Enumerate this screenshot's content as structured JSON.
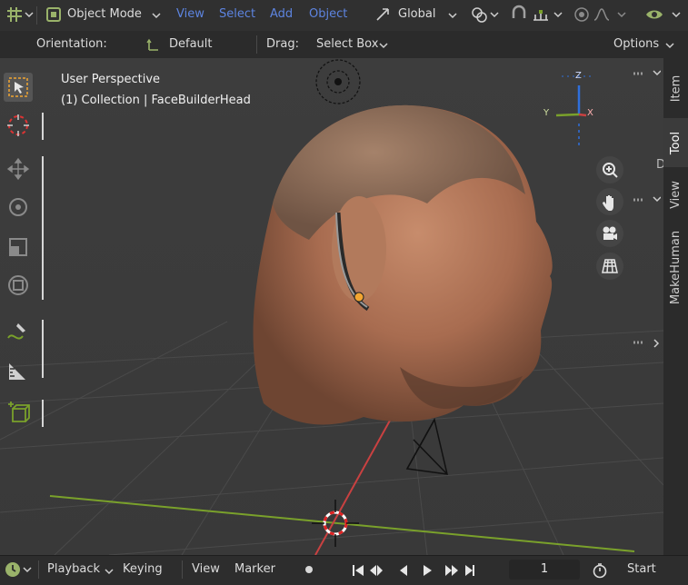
{
  "header": {
    "mode": "Object Mode",
    "menus": [
      "View",
      "Select",
      "Add",
      "Object"
    ],
    "transform_orientation": "Global"
  },
  "tool_settings": {
    "orientation_label": "Orientation:",
    "orientation_value": "Default",
    "drag_label": "Drag:",
    "drag_value": "Select Box",
    "options_label": "Options"
  },
  "viewport": {
    "view_name": "User Perspective",
    "collection_info": "(1) Collection | FaceBuilderHead",
    "gizmo": {
      "z": "Z",
      "y": "Y",
      "x": "X"
    },
    "cutoff_letter": "D"
  },
  "sidebar_tabs": [
    "Item",
    "Tool",
    "View",
    "MakeHuman"
  ],
  "sidebar_active": "Tool",
  "timeline": {
    "playback": "Playback",
    "keying": "Keying",
    "view": "View",
    "marker": "Marker",
    "current_frame": "1",
    "start_label": "Start"
  },
  "colors": {
    "header_bg": "#303030",
    "viewport_bg": "#3a3a3a",
    "menu_blue": "#5d84e0",
    "x_axis": "#c94141",
    "y_axis": "#7aa12b",
    "z_axis": "#2f6fdc",
    "active_orange": "#f2a531"
  }
}
